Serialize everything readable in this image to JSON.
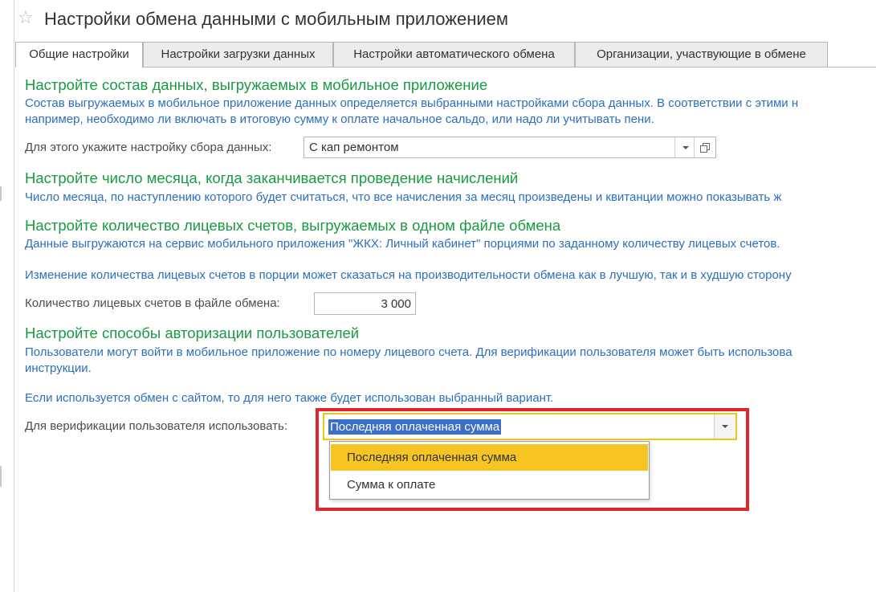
{
  "header": {
    "favorite_icon": "star-icon",
    "title": "Настройки обмена данными с мобильным приложением"
  },
  "tabs": [
    {
      "label": "Общие настройки",
      "active": true
    },
    {
      "label": "Настройки загрузки данных",
      "active": false
    },
    {
      "label": "Настройки автоматического обмена",
      "active": false
    },
    {
      "label": "Организации, участвующие в обмене",
      "active": false
    }
  ],
  "sections": {
    "data_composition": {
      "heading": "Настройте состав данных, выгружаемых в мобильное приложение",
      "description_line1": "Состав выгружаемых в мобильное приложение данных определяется выбранными настройками сбора данных. В соответствии с этими н",
      "description_line2": "например, необходимо ли включать в итоговую сумму к оплате начальное сальдо, или надо ли учитывать пени.",
      "field_label": "Для этого укажите настройку сбора данных:",
      "field_value": "С кап ремонтом"
    },
    "accrual_day": {
      "heading": "Настройте число месяца, когда заканчивается проведение начислений",
      "description": "Число месяца, по наступлению которого будет считаться, что все начисления за месяц произведены и квитанции можно показывать ж"
    },
    "accounts_count": {
      "heading": "Настройте количество лицевых счетов, выгружаемых в одном файле обмена",
      "description_line1": "Данные выгружаются на сервис мобильного приложения \"ЖКХ: Личный кабинет\" порциями по заданному количеству лицевых счетов.",
      "description_line2": "Изменение количества лицевых счетов в порции может сказаться на производительности обмена как в лучшую, так и в худшую сторону",
      "field_label": "Количество лицевых счетов в файле обмена:",
      "field_value": "3 000"
    },
    "authorization": {
      "heading": "Настройте способы авторизации пользователей",
      "description_line1": "Пользователи могут войти в мобильное приложение по номеру лицевого счета. Для верификации пользователя может быть использова",
      "description_line2": "инструкции.",
      "description_line3": "Если используется обмен с сайтом, то для него также будет использован выбранный вариант.",
      "field_label": "Для верификации пользователя использовать:",
      "field_value": "Последняя оплаченная сумма",
      "options": [
        {
          "label": "Последняя оплаченная сумма",
          "highlighted": true
        },
        {
          "label": "Сумма к оплате",
          "highlighted": false
        }
      ]
    }
  },
  "colors": {
    "heading": "#1a9a42",
    "info_text": "#2c6fbd",
    "highlight_frame": "#e2242c",
    "option_highlight": "#f6c524",
    "selection": "#3b6fc9"
  }
}
